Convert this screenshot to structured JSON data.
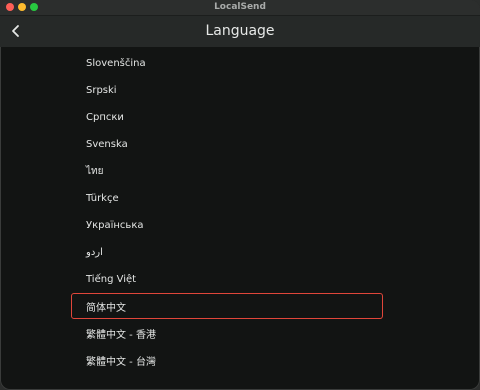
{
  "window": {
    "title": "LocalSend"
  },
  "header": {
    "title": "Language",
    "back_icon": "chevron-left-icon"
  },
  "languages": [
    {
      "label": "Slovenščina",
      "selected": false
    },
    {
      "label": "Srpski",
      "selected": false
    },
    {
      "label": "Српски",
      "selected": false
    },
    {
      "label": "Svenska",
      "selected": false
    },
    {
      "label": "ไทย",
      "selected": false
    },
    {
      "label": "Türkçe",
      "selected": false
    },
    {
      "label": "Українська",
      "selected": false
    },
    {
      "label": "اردو",
      "selected": false
    },
    {
      "label": "Tiếng Việt",
      "selected": false
    },
    {
      "label": "简体中文",
      "selected": true
    },
    {
      "label": "繁體中文 - 香港",
      "selected": false
    },
    {
      "label": "繁體中文 - 台灣",
      "selected": false
    }
  ],
  "colors": {
    "selection_border": "#e0463a",
    "background": "#121413",
    "appbar": "#262928"
  }
}
